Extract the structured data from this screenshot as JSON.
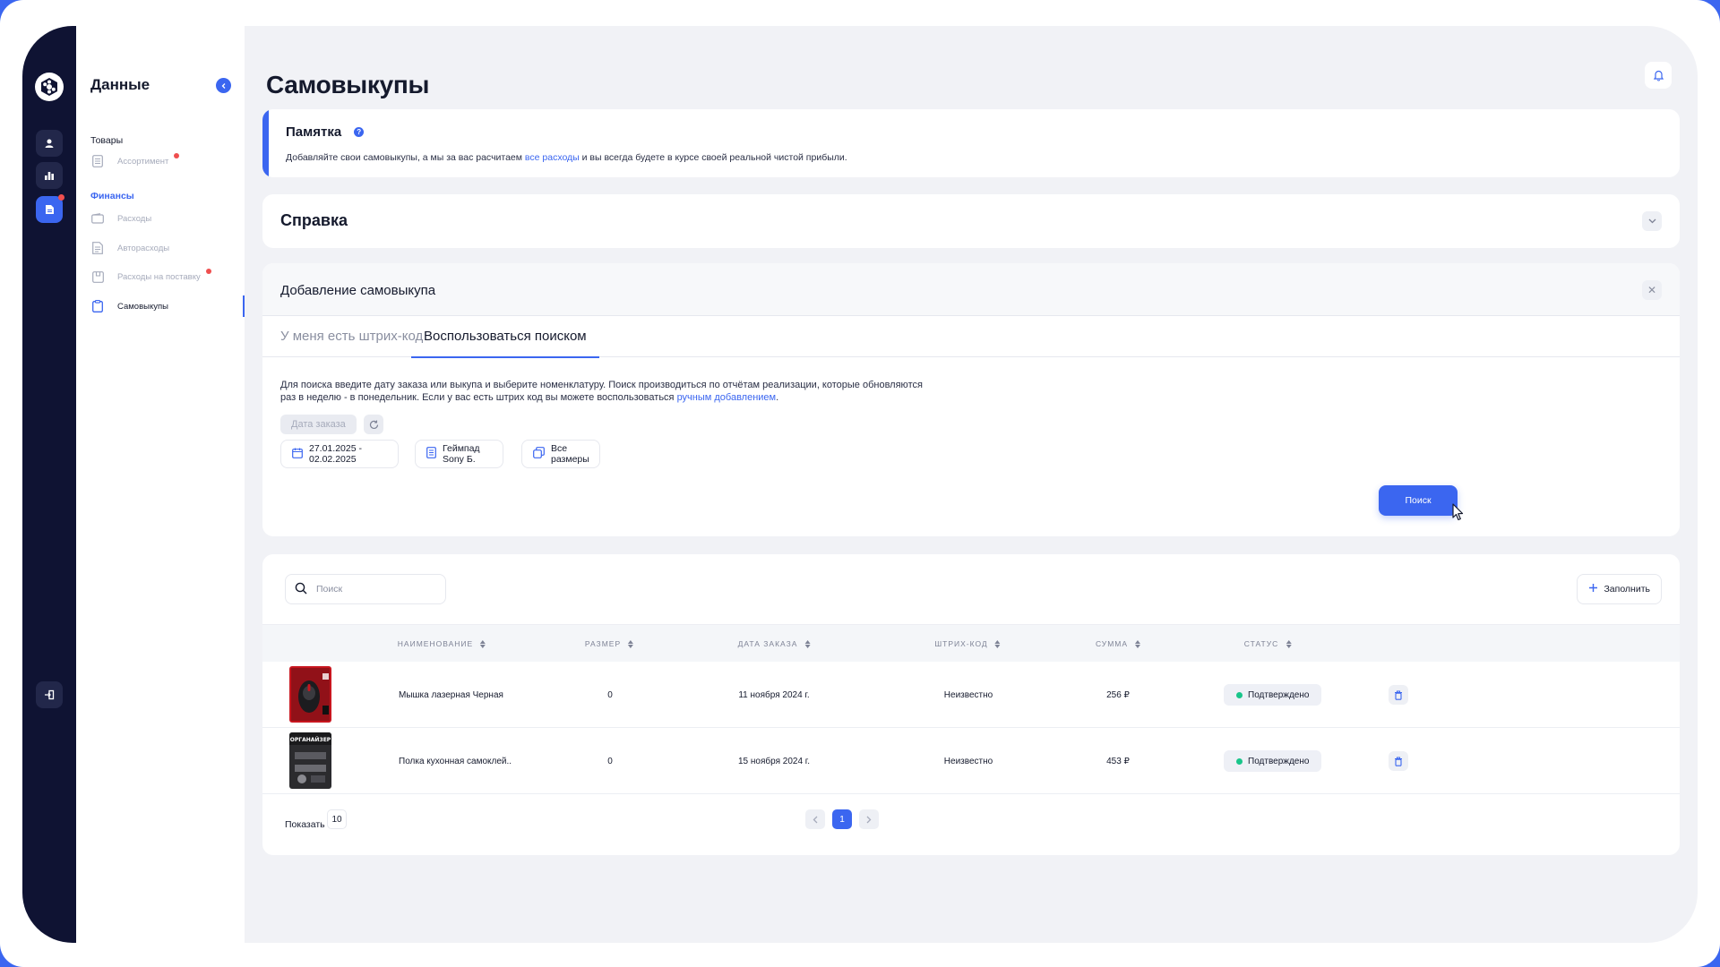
{
  "sidebar": {
    "title": "Данные",
    "groups": {
      "goods": "Товары",
      "finance": "Финансы"
    },
    "items": {
      "assortment": "Ассортимент",
      "expenses": "Расходы",
      "auto_expenses": "Авторасходы",
      "supply_expenses": "Расходы на поставку",
      "self_purchases": "Самовыкупы"
    }
  },
  "page": {
    "title": "Самовыкупы"
  },
  "memo": {
    "title": "Памятка",
    "text_before": "Добавляйте свои самовыкупы, а мы за вас расчитаем ",
    "link": "все расходы",
    "text_after": " и вы всегда будете в курсе своей реальной чистой прибыли."
  },
  "reference": {
    "title": "Справка"
  },
  "add_form": {
    "title": "Добавление самовыкупа",
    "tabs": [
      "У меня есть штрих-код",
      "Воспользоваться поиском"
    ],
    "desc_before": "Для поиска введите дату заказа или выкупа и выберите номенклатуру. Поиск производиться по отчётам реализации, которые обновляются раз в неделю - в понедельник. Если у вас есть штрих код вы можете воспользоваться ",
    "desc_link": "ручным добавлением",
    "desc_after": ".",
    "date_type": "Дата заказа",
    "date_range": "27.01.2025 - 02.02.2025",
    "product": "Геймпад Sony Б.",
    "sizes": "Все размеры",
    "search_button": "Поиск"
  },
  "table": {
    "search_placeholder": "Поиск",
    "fill_button": "Заполнить",
    "columns": [
      "НАИМЕНОВАНИЕ",
      "РАЗМЕР",
      "ДАТА ЗАКАЗА",
      "ШТРИХ-КОД",
      "СУММА",
      "СТАТУС"
    ],
    "rows": [
      {
        "name": "Мышка лазерная Черная",
        "size": "0",
        "date": "11 ноября 2024 г.",
        "barcode": "Неизвестно",
        "sum": "256 ₽",
        "status": "Подтверждено",
        "thumb_text": ""
      },
      {
        "name": "Полка кухонная самоклей..",
        "size": "0",
        "date": "15 ноября 2024 г.",
        "barcode": "Неизвестно",
        "sum": "453 ₽",
        "status": "Подтверждено",
        "thumb_text": "ОРГАНАЙЗЕР"
      }
    ],
    "show_label": "Показать",
    "show_value": "10",
    "current_page": "1"
  },
  "colors": {
    "accent": "#3b66f0",
    "rail": "#0f1333",
    "success": "#19c58a",
    "alert": "#ef4f4f"
  }
}
